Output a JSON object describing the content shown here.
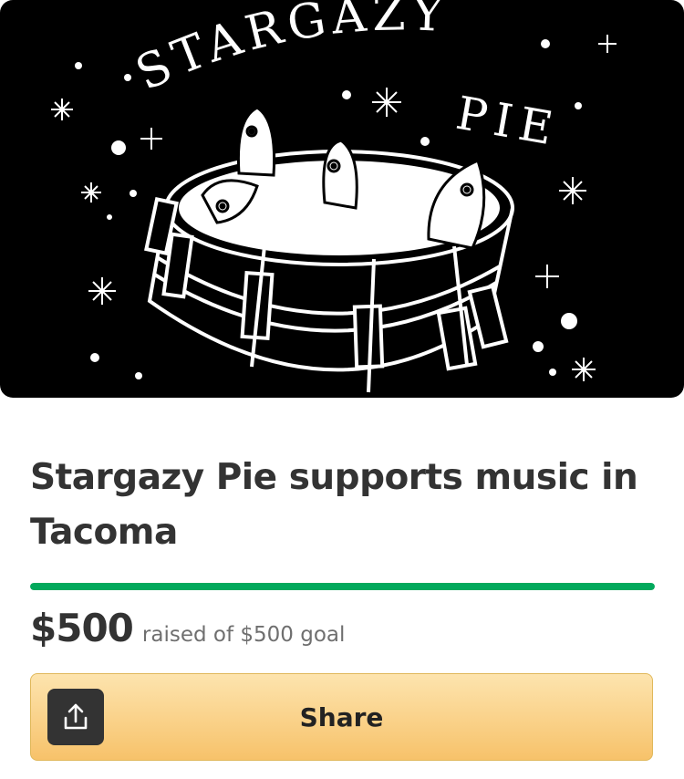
{
  "hero": {
    "image_text_line1": "STARGAZY",
    "image_text_line2": "PIE"
  },
  "campaign": {
    "title": "Stargazy Pie supports music in Tacoma",
    "raised_amount": "$500",
    "goal_text": "raised of $500 goal",
    "progress_fraction": 1.0
  },
  "actions": {
    "share_label": "Share",
    "share_icon": "share-upload-icon"
  },
  "colors": {
    "progress": "#02a95c",
    "share_button": "#f7c26a",
    "title_text": "#333333"
  }
}
